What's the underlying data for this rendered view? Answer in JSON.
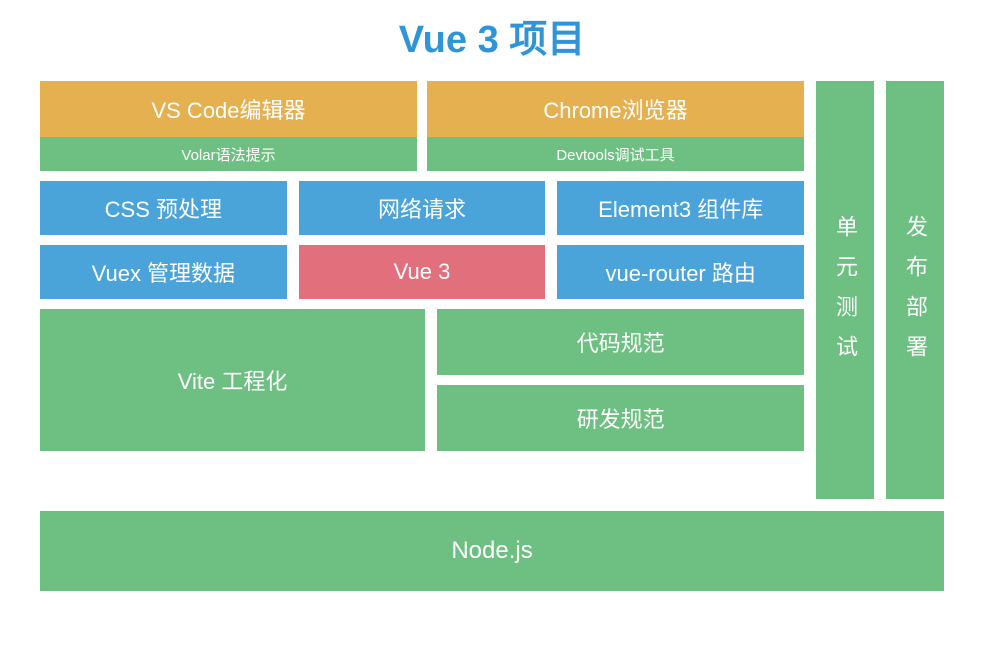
{
  "title": "Vue 3 项目",
  "editors": {
    "left": {
      "name": "VS Code编辑器",
      "sub": "Volar语法提示"
    },
    "right": {
      "name": "Chrome浏览器",
      "sub": "Devtools调试工具"
    }
  },
  "row2": {
    "a": "CSS 预处理",
    "b": "网络请求",
    "c": "Element3 组件库"
  },
  "row3": {
    "a": "Vuex 管理数据",
    "b": "Vue 3",
    "c": "vue-router 路由"
  },
  "vite": "Vite 工程化",
  "specs": {
    "code": "代码规范",
    "dev": "研发规范"
  },
  "side": {
    "test": "单元测试",
    "deploy": "发布部署"
  },
  "bottom": "Node.js"
}
